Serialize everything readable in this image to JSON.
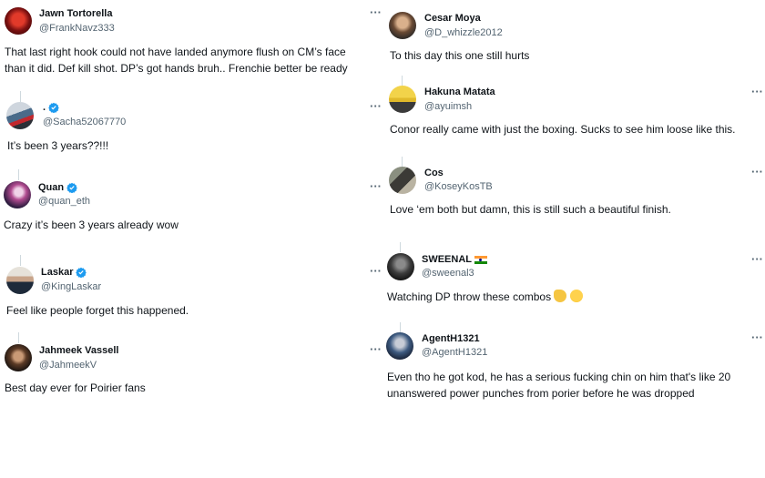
{
  "tweets_left": [
    {
      "name": "Jawn Tortorella",
      "handle": "@FrankNavz333",
      "text": "That last right hook could not have landed anymore flush on CM’s face",
      "text2": "than it did. Def kill shot. DP’s got hands bruh.. Frenchie better be ready"
    },
    {
      "name": ".",
      "handle": "@Sacha52067770",
      "text": "It’s been 3 years??!!!"
    },
    {
      "name": "Quan",
      "handle": "@quan_eth",
      "text": "Crazy it’s been 3 years already wow"
    },
    {
      "name": "Laskar",
      "handle": "@KingLaskar",
      "text": "Feel like people forget this happened."
    },
    {
      "name": "Jahmeek Vassell",
      "handle": "@JahmeekV",
      "text": "Best day ever for Poirier fans"
    }
  ],
  "tweets_right": [
    {
      "name": "Cesar Moya",
      "handle": "@D_whizzle2012",
      "text": "To this day this one still hurts"
    },
    {
      "name": "Hakuna Matata",
      "handle": "@ayuimsh",
      "text": "Conor really came with just the boxing. Sucks to see him loose like this."
    },
    {
      "name": "Cos",
      "handle": "@KoseyKosTB",
      "text": "Love ‘em both but damn, this is still such a beautiful finish."
    },
    {
      "name": "SWEENAL",
      "handle": "@sweenal3",
      "text": "Watching DP throw these combos"
    },
    {
      "name": "AgentH1321",
      "handle": "@AgentH1321",
      "text": "Even tho he got kod, he has a serious fucking chin on him that's like 20",
      "text2": "unanswered power punches from porier before he was dropped"
    }
  ],
  "more_label": "···",
  "colors": {
    "verified": "#1d9bf0",
    "text": "#0f1419",
    "muted": "#536471",
    "line": "#cfd9de"
  }
}
